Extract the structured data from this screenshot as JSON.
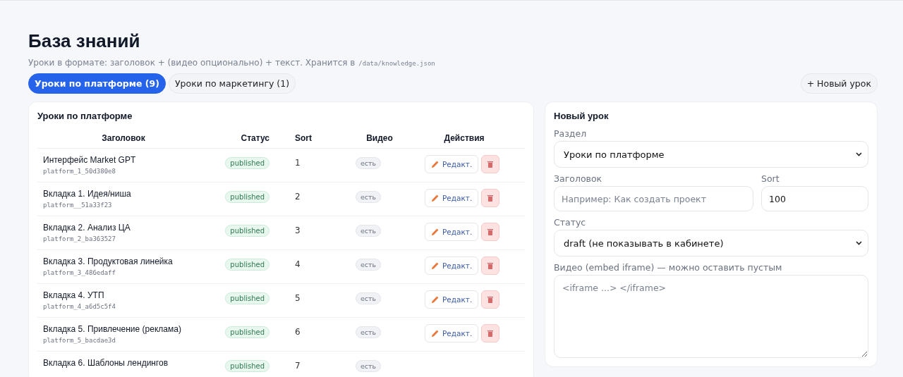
{
  "page": {
    "title": "База знаний",
    "subtitle": "Уроки в формате: заголовок + (видео опционально) + текст. Хранится в",
    "path": "/data/knowledge.json"
  },
  "tabs": [
    {
      "label": "Уроки по платформе (9)",
      "selected": true
    },
    {
      "label": "Уроки по маркетингу (1)",
      "selected": false
    }
  ],
  "new_button": "+ Новый урок",
  "list": {
    "title": "Уроки по платформе",
    "columns": [
      "Заголовок",
      "Статус",
      "Sort",
      "Видео",
      "Действия"
    ],
    "rows": [
      {
        "title": "Интерфейс Market GPT",
        "id": "platform_1_50d380e8",
        "status": "published",
        "sort": "1",
        "video": "есть",
        "edit": "Редакт."
      },
      {
        "title": "Вкладка 1. Идея/ниша",
        "id": "platform__51a33f23",
        "status": "published",
        "sort": "2",
        "video": "есть",
        "edit": "Редакт."
      },
      {
        "title": "Вкладка 2. Анализ ЦА",
        "id": "platform_2_ba363527",
        "status": "published",
        "sort": "3",
        "video": "есть",
        "edit": "Редакт."
      },
      {
        "title": "Вкладка 3. Продуктовая линейка",
        "id": "platform_3_486edaff",
        "status": "published",
        "sort": "4",
        "video": "есть",
        "edit": "Редакт."
      },
      {
        "title": "Вкладка 4. УТП",
        "id": "platform_4_a6d5c5f4",
        "status": "published",
        "sort": "5",
        "video": "есть",
        "edit": "Редакт."
      },
      {
        "title": "Вкладка 5. Привлечение (реклама)",
        "id": "platform_5_bacdae3d",
        "status": "published",
        "sort": "6",
        "video": "есть",
        "edit": "Редакт."
      },
      {
        "title": "Вкладка 6. Шаблоны лендингов",
        "status": "published",
        "sort": "7",
        "video": "есть"
      }
    ]
  },
  "form": {
    "title": "Новый урок",
    "section": {
      "label": "Раздел",
      "value": "Уроки по платформе"
    },
    "heading": {
      "label": "Заголовок",
      "placeholder": "Например: Как создать проект"
    },
    "sort": {
      "label": "Sort",
      "value": "100"
    },
    "status": {
      "label": "Статус",
      "value": "draft (не показывать в кабинете)"
    },
    "video": {
      "label": "Видео (embed iframe) — можно оставить пустым",
      "placeholder": "<iframe ...> </iframe>"
    }
  }
}
